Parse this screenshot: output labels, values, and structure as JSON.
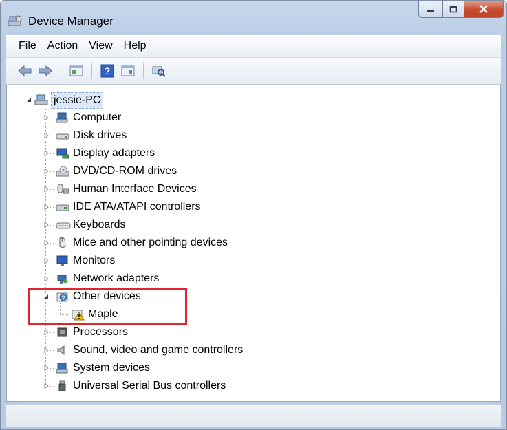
{
  "window": {
    "title": "Device Manager"
  },
  "menu": [
    "File",
    "Action",
    "View",
    "Help"
  ],
  "toolbar": {
    "buttons": [
      "back-icon",
      "forward-icon",
      "properties-icon",
      "help-icon",
      "show-hidden-icon",
      "scan-hardware-icon"
    ]
  },
  "tree": {
    "root": "jessie-PC",
    "categories": [
      {
        "label": "Computer",
        "icon": "computer-icon",
        "expanded": false
      },
      {
        "label": "Disk drives",
        "icon": "disk-drive-icon",
        "expanded": false
      },
      {
        "label": "Display adapters",
        "icon": "display-adapter-icon",
        "expanded": false
      },
      {
        "label": "DVD/CD-ROM drives",
        "icon": "dvd-drive-icon",
        "expanded": false
      },
      {
        "label": "Human Interface Devices",
        "icon": "hid-icon",
        "expanded": false
      },
      {
        "label": "IDE ATA/ATAPI controllers",
        "icon": "ide-controller-icon",
        "expanded": false
      },
      {
        "label": "Keyboards",
        "icon": "keyboard-icon",
        "expanded": false
      },
      {
        "label": "Mice and other pointing devices",
        "icon": "mouse-icon",
        "expanded": false
      },
      {
        "label": "Monitors",
        "icon": "monitor-icon",
        "expanded": false
      },
      {
        "label": "Network adapters",
        "icon": "network-adapter-icon",
        "expanded": false
      },
      {
        "label": "Other devices",
        "icon": "unknown-device-icon",
        "expanded": true,
        "children": [
          {
            "label": "Maple",
            "icon": "warning-device-icon"
          }
        ]
      },
      {
        "label": "Processors",
        "icon": "processor-icon",
        "expanded": false
      },
      {
        "label": "Sound, video and game controllers",
        "icon": "sound-icon",
        "expanded": false
      },
      {
        "label": "System devices",
        "icon": "system-device-icon",
        "expanded": false
      },
      {
        "label": "Universal Serial Bus controllers",
        "icon": "usb-icon",
        "expanded": false
      }
    ]
  },
  "colors": {
    "highlight_box": "#e0262c",
    "selection": "#dce8f7"
  }
}
